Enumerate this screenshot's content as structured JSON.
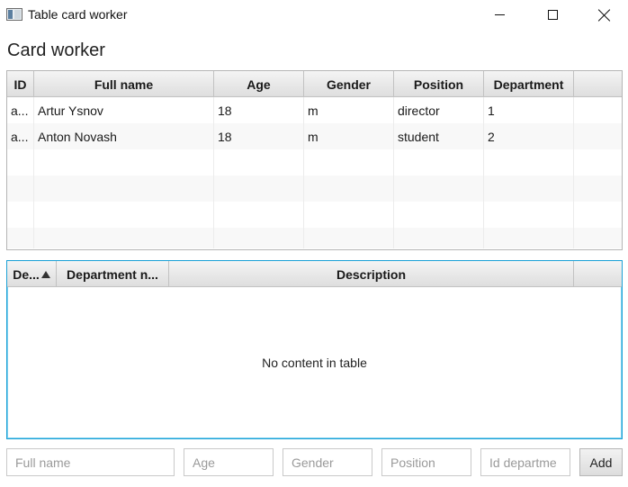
{
  "window": {
    "title": "Table card worker"
  },
  "heading": "Card worker",
  "workers_table": {
    "columns": [
      "ID",
      "Full name",
      "Age",
      "Gender",
      "Position",
      "Department"
    ],
    "rows": [
      [
        "a...",
        "Artur Ysnov",
        "18",
        "m",
        "director",
        "1"
      ],
      [
        "a...",
        "Anton Novash",
        "18",
        "m",
        "student",
        "2"
      ]
    ]
  },
  "departments_table": {
    "columns": [
      "De...",
      "Department n...",
      "Description"
    ],
    "sort_column": "De...",
    "sort_direction": "ascending",
    "empty_message": "No content in table"
  },
  "form": {
    "full_name_placeholder": "Full name",
    "age_placeholder": "Age",
    "gender_placeholder": "Gender",
    "position_placeholder": "Position",
    "department_id_placeholder": "Id departme",
    "add_label": "Add"
  },
  "colors": {
    "focus_border": "#1ba1d6",
    "header_gradient_top": "#f4f4f4",
    "header_gradient_bottom": "#dedede"
  }
}
